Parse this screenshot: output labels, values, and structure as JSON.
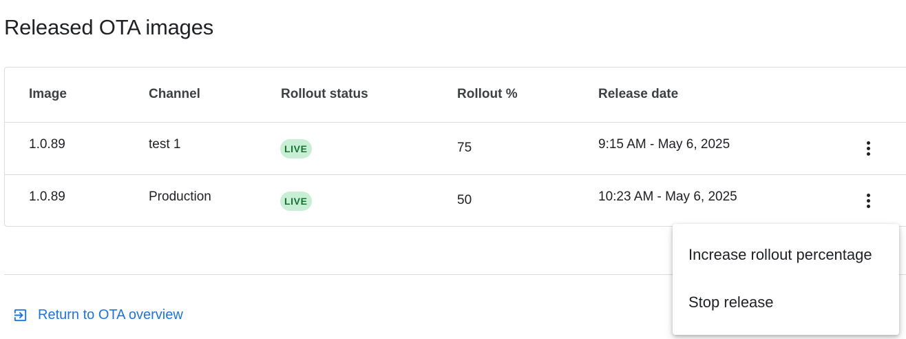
{
  "page": {
    "title": "Released OTA images"
  },
  "table": {
    "columns": [
      "Image",
      "Channel",
      "Rollout status",
      "Rollout %",
      "Release date"
    ],
    "rows": [
      {
        "image": "1.0.89",
        "channel": "test 1",
        "status": "LIVE",
        "rollout": "75",
        "date": "9:15 AM - May 6, 2025"
      },
      {
        "image": "1.0.89",
        "channel": "Production",
        "status": "LIVE",
        "rollout": "50",
        "date": "10:23 AM - May 6, 2025"
      }
    ]
  },
  "menu": {
    "items": [
      "Increase rollout percentage",
      "Stop release"
    ]
  },
  "footer": {
    "return_label": "Return to OTA overview"
  },
  "icons": {
    "row_menu": "more-vert-icon",
    "return": "exit-to-app-icon"
  },
  "colors": {
    "link": "#1a73e8",
    "badge_bg": "#c8efd4",
    "badge_text": "#137333"
  }
}
